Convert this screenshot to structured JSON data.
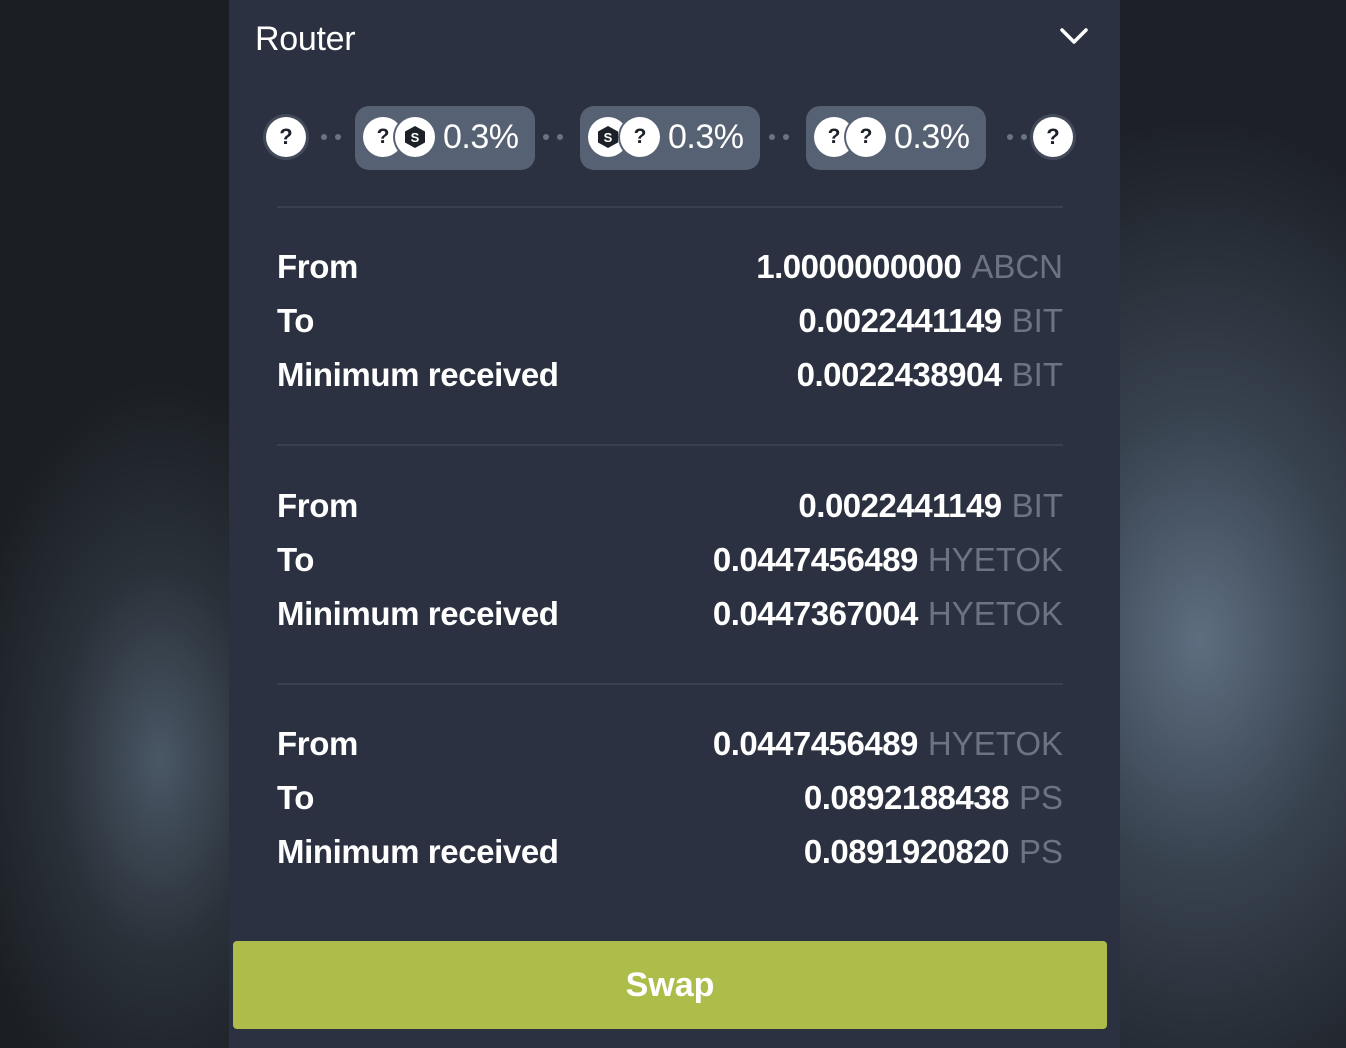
{
  "router": {
    "title": "Router",
    "route": {
      "start_token_icon": "question-mark",
      "end_token_icon": "question-mark",
      "pools": [
        {
          "fee": "0.3%",
          "icons": [
            "question-mark",
            "hexagon-token-logo"
          ]
        },
        {
          "fee": "0.3%",
          "icons": [
            "hexagon-token-logo",
            "question-mark"
          ]
        },
        {
          "fee": "0.3%",
          "icons": [
            "question-mark",
            "question-mark"
          ]
        }
      ]
    },
    "steps": [
      {
        "from_label": "From",
        "from_amount": "1.0000000000",
        "from_symbol": "ABCN",
        "to_label": "To",
        "to_amount": "0.0022441149",
        "to_symbol": "BIT",
        "min_label": "Minimum received",
        "min_amount": "0.0022438904",
        "min_symbol": "BIT"
      },
      {
        "from_label": "From",
        "from_amount": "0.0022441149",
        "from_symbol": "BIT",
        "to_label": "To",
        "to_amount": "0.0447456489",
        "to_symbol": "HYETOK",
        "min_label": "Minimum received",
        "min_amount": "0.0447367004",
        "min_symbol": "HYETOK"
      },
      {
        "from_label": "From",
        "from_amount": "0.0447456489",
        "from_symbol": "HYETOK",
        "to_label": "To",
        "to_amount": "0.0892188438",
        "to_symbol": "PS",
        "min_label": "Minimum received",
        "min_amount": "0.0891920820",
        "min_symbol": "PS"
      }
    ]
  },
  "swap_button": {
    "label": "Swap"
  },
  "colors": {
    "panel": "#2b3140",
    "pool_chip": "#566173",
    "accent": "#aebd4a",
    "muted_symbol": "#6c7482"
  }
}
